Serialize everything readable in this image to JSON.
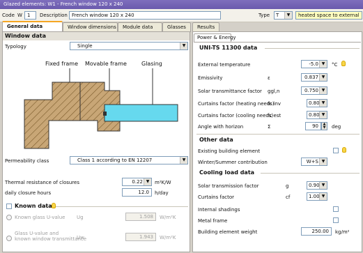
{
  "title": "Glazed elements: W1 - French window 120 x 240",
  "header": {
    "code_label": "Code",
    "code_prefix": "W",
    "code_value": "1",
    "description_label": "Description",
    "description_value": "French window 120 x 240",
    "type_label": "Type",
    "type_value": "T",
    "type_desc": "heated space to external"
  },
  "tabs": [
    "General data",
    "Window dimensions",
    "Module data",
    "Glasses",
    "Results"
  ],
  "left": {
    "window_data_title": "Window data",
    "typology_label": "Typology",
    "typology_value": "Single",
    "diagram_labels": {
      "fixed": "Fixed frame",
      "movable": "Movable frame",
      "glazing": "Glasing"
    },
    "permeability_label": "Permeability class",
    "permeability_value": "Class 1 according to EN 12207",
    "thermal_label": "Thermal resistance of closures",
    "thermal_value": "0.22",
    "thermal_unit": "m²K/W",
    "closure_label": "daily closure hours",
    "closure_value": "12.0",
    "closure_unit": "h/day",
    "known_title": "Known data",
    "known_glass_label": "Known glass U-value",
    "ug_label": "Ug",
    "ug_value": "1.508",
    "ug_unit": "W/m²K",
    "glass_u_label_1": "Glass U-value and",
    "glass_u_label_2": "known window transmittance",
    "uw_label": "Uw",
    "uw_value": "1.943",
    "uw_unit": "W/m²K"
  },
  "right": {
    "subtab": "Power & Energy",
    "uni_title": "UNI-TS 11300 data",
    "ext_temp_label": "External temperature",
    "ext_temp_value": "-5.0",
    "ext_temp_unit": "°C",
    "emissivity_label": "Emissivity",
    "emissivity_sym": "ε",
    "emissivity_value": "0.837",
    "solar_label": "Solar transmittance factor",
    "solar_sym": "ggl,n",
    "solar_value": "0.750",
    "curt_heat_label": "Curtains factor (heating needs)",
    "curt_heat_sym": "fc inv",
    "curt_heat_value": "0.80",
    "curt_cool_label": "Curtains factor (cooling needs)",
    "curt_cool_sym": "fc est",
    "curt_cool_value": "0.80",
    "angle_label": "Angle with horizon",
    "angle_sym": "Σ",
    "angle_value": "90",
    "angle_unit": "deg",
    "other_title": "Other data",
    "existing_label": "Existing building element",
    "winter_label": "Winter/Summer contribution",
    "winter_value": "W+S",
    "cooling_title": "Cooling load data",
    "solar_tx_label": "Solar transmission factor",
    "solar_tx_sym": "g",
    "solar_tx_value": "0.90",
    "curtains_label": "Curtains factor",
    "curtains_sym": "cf",
    "curtains_value": "1.00",
    "internal_label": "Internal shadings",
    "metal_label": "Metal frame",
    "bldg_weight_label": "Building element weight",
    "bldg_weight_value": "250.00",
    "bldg_weight_unit": "kg/m²"
  },
  "colors": {
    "title_bar": "#6a5aad",
    "accent_tab": "#f5a623",
    "glazing": "#66d9ee",
    "frame": "#c8a676",
    "field_yellow": "#ffffc0"
  }
}
